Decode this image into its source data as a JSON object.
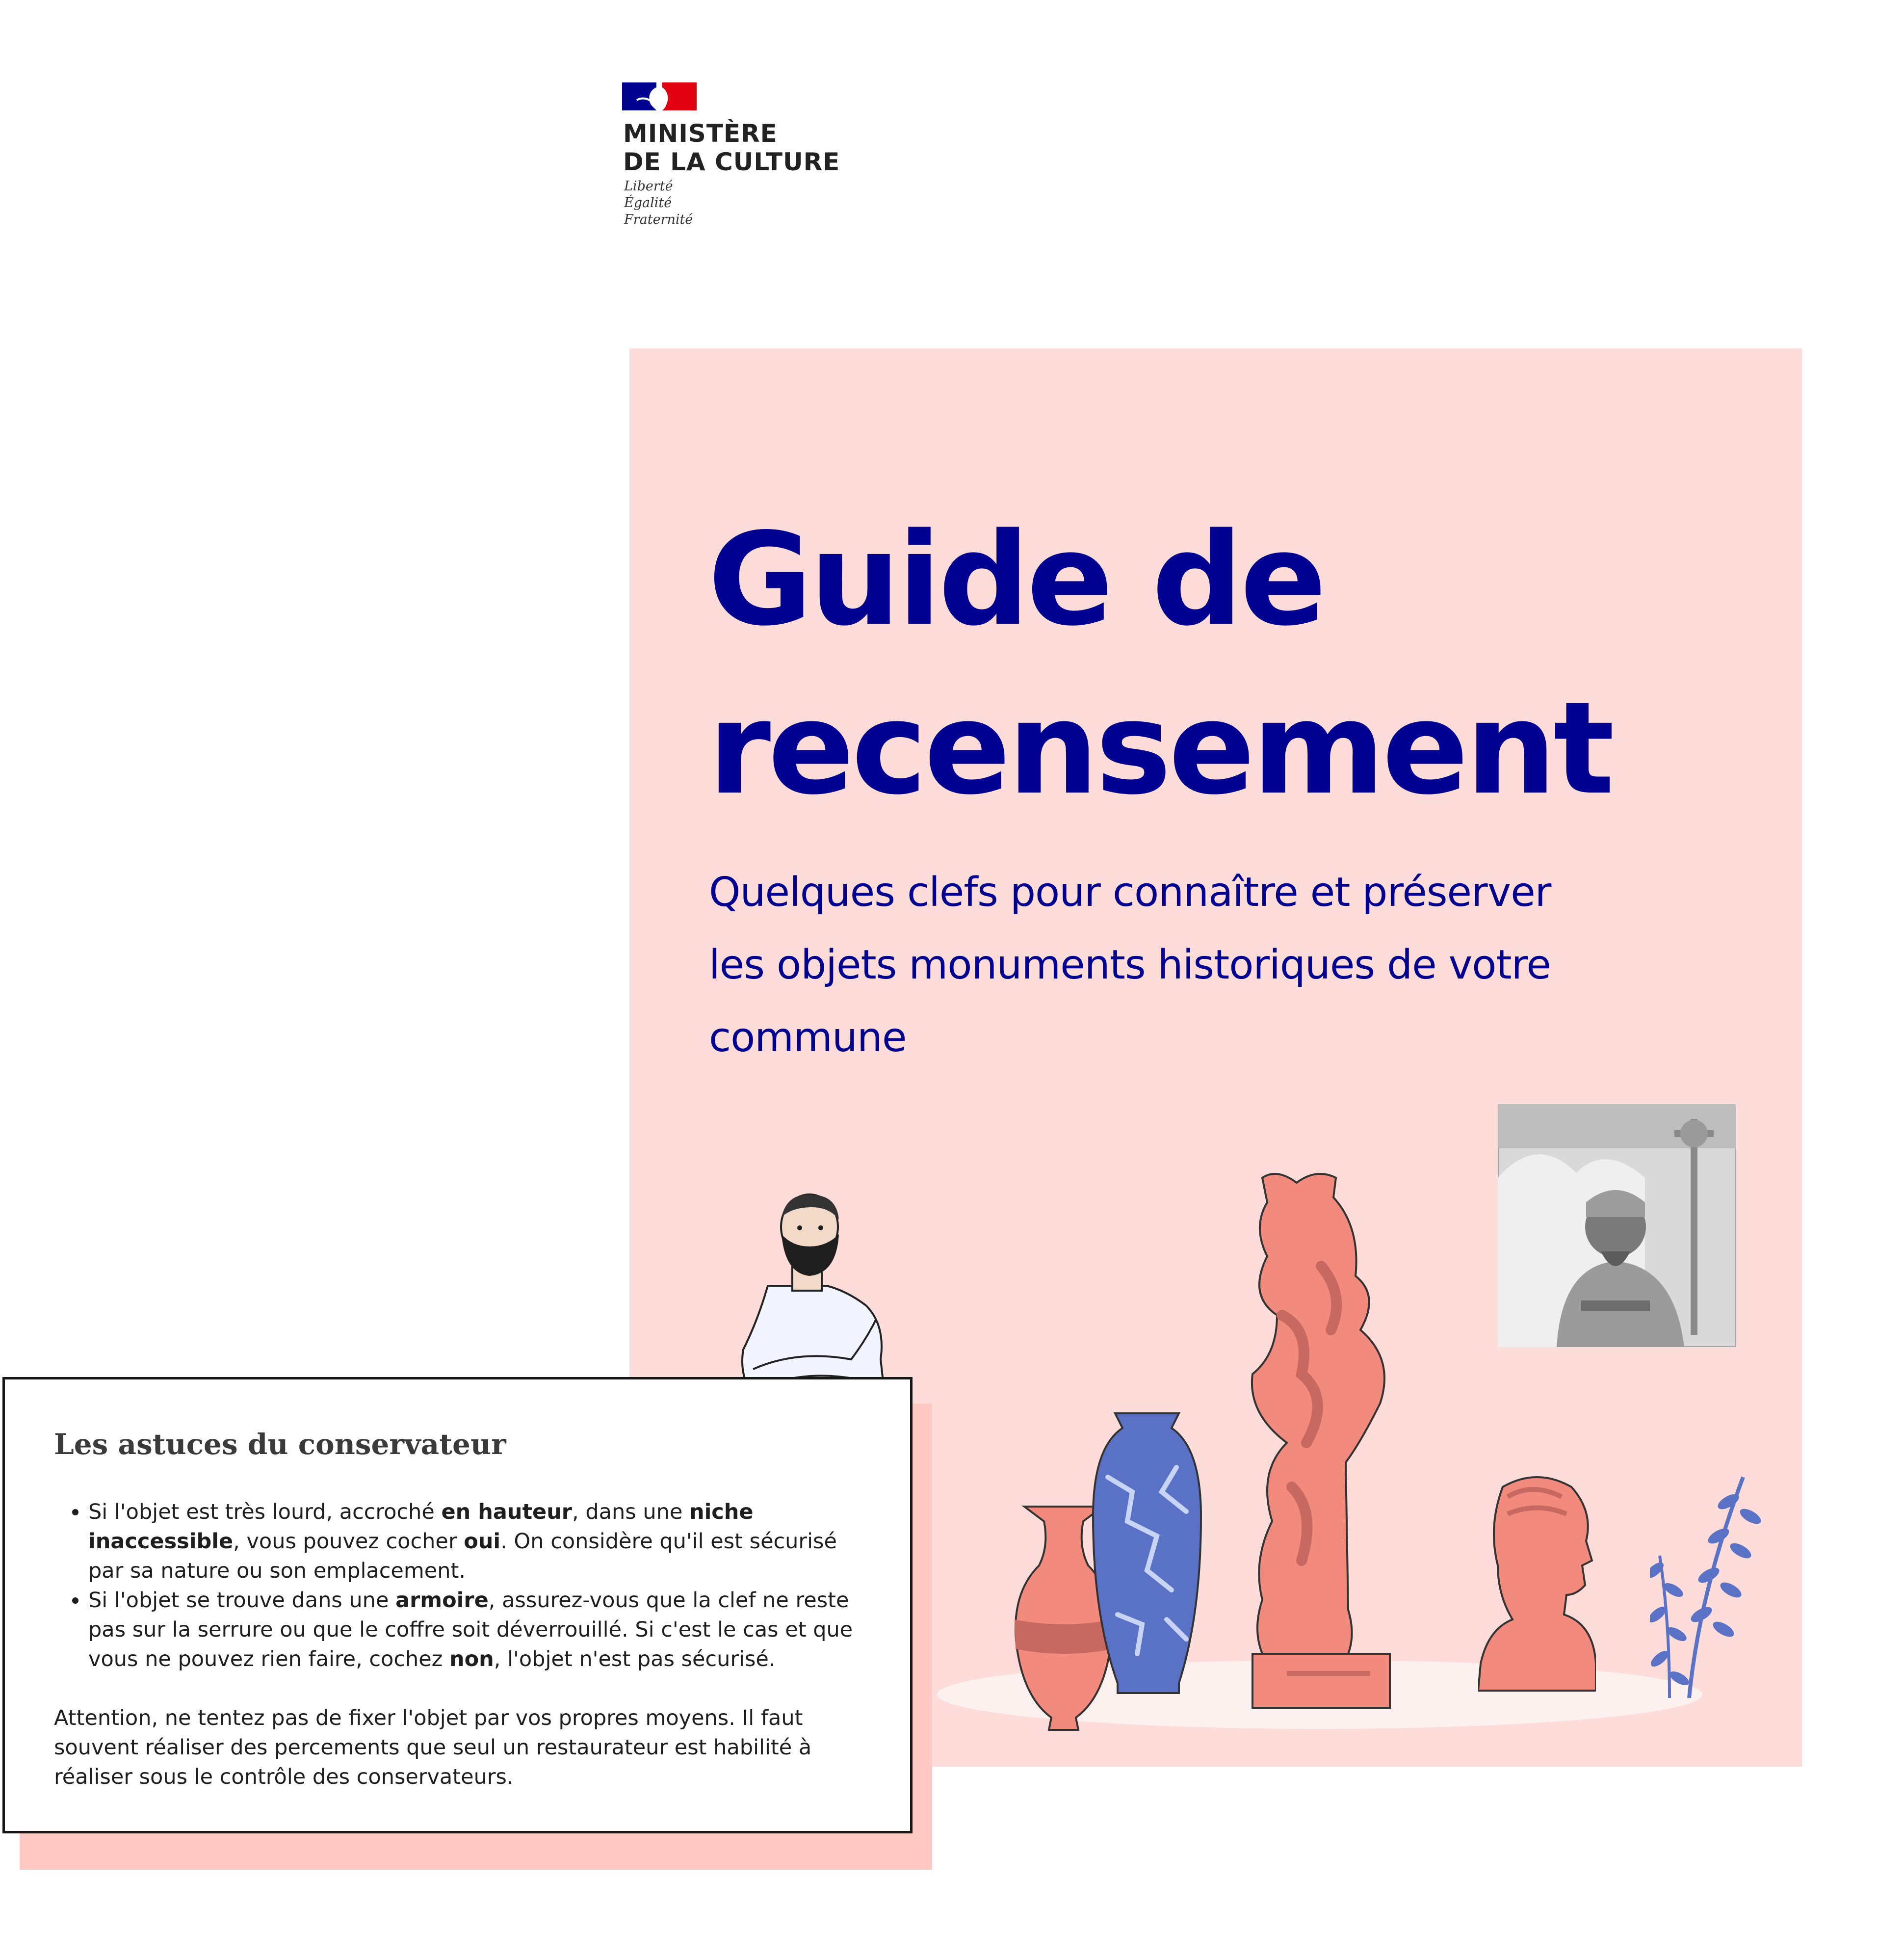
{
  "logo": {
    "line1": "MINISTÈRE",
    "line2": "DE LA CULTURE",
    "motto": [
      "Liberté",
      "Égalité",
      "Fraternité"
    ],
    "colors": {
      "blue": "#000091",
      "red": "#e1000f"
    }
  },
  "cover": {
    "title": "Guide de recensement",
    "subtitle": "Quelques clefs pour connaître et préserver les objets monuments historiques de votre commune",
    "background": "#fddcd9",
    "title_color": "#000091"
  },
  "callout": {
    "title": "Les astuces du conservateur",
    "tips": [
      [
        {
          "t": "Si l'objet est très lourd, accroché "
        },
        {
          "t": "en hauteur",
          "b": true
        },
        {
          "t": ", dans une "
        },
        {
          "t": "niche inaccessible",
          "b": true
        },
        {
          "t": ", vous pouvez cocher "
        },
        {
          "t": "oui",
          "b": true
        },
        {
          "t": ". On considère qu'il est sécurisé par sa nature ou son emplacement."
        }
      ],
      [
        {
          "t": "Si l'objet se trouve dans une "
        },
        {
          "t": "armoire",
          "b": true
        },
        {
          "t": ", assurez-vous que la clef ne reste pas sur la serrure ou que le coffre soit déverrouillé. Si c'est le cas et que vous ne pouvez rien faire, cochez "
        },
        {
          "t": "non",
          "b": true
        },
        {
          "t": ", l'objet n'est pas sécurisé."
        }
      ]
    ],
    "warning": "Attention, ne tentez pas de fixer l'objet par vos propres moyens. Il faut souvent réaliser des percements que seul un restaurateur est habilité à réaliser sous le contrôle des conservateurs.",
    "accent": "#ffc9c3"
  }
}
